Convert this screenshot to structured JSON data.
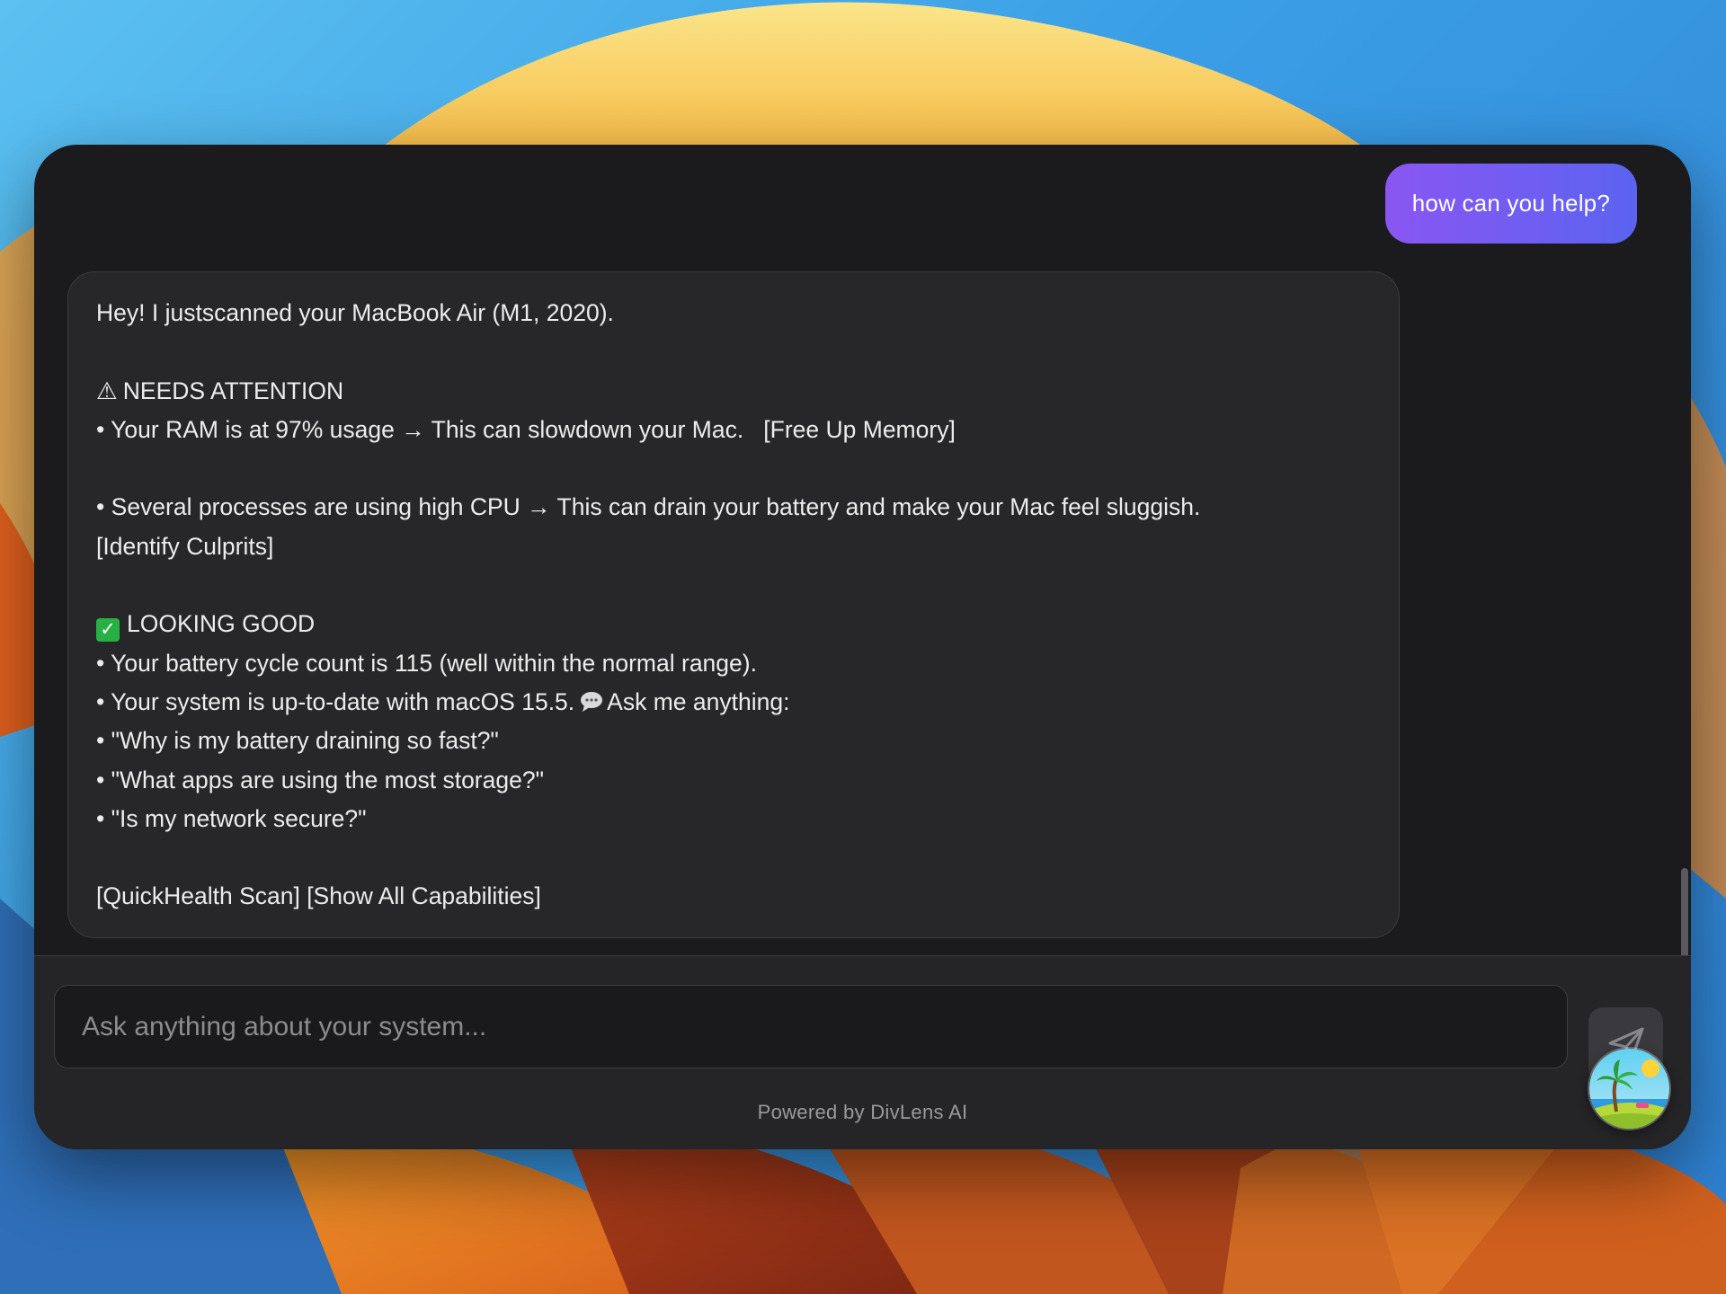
{
  "chat": {
    "user_message": "how can you help?",
    "assistant_lines": [
      "Hey! I justscanned your MacBook Air (M1, 2020).",
      "",
      "NEEDS ATTENTION",
      "• Your RAM is at 97% usage → This can slowdown your Mac.   [Free Up Memory]",
      "",
      "• Several processes are using high CPU → This can drain your battery and make your Mac feel sluggish.",
      "[Identify Culprits]",
      "",
      "LOOKING GOOD",
      "• Your battery cycle count is 115 (well within the normal range).",
      "• Your system is up-to-date with macOS 15.5.",
      "Ask me anything:",
      "• \"Why is my battery draining so fast?\"",
      "• \"What apps are using the most storage?\"",
      "• \"Is my network secure?\"",
      "",
      "[QuickHealth Scan] [Show All Capabilities]"
    ],
    "warning_glyph": "⚠",
    "check_glyph": "✓"
  },
  "input": {
    "placeholder": "Ask anything about your system...",
    "value": ""
  },
  "footer": {
    "powered_by": "Powered by DivLens AI"
  },
  "icons": {
    "send": "send-paper-plane-icon",
    "warning": "warning-triangle-icon",
    "check": "check-mark-icon",
    "speech": "speech-bubble-icon",
    "avatar": "island-palm-avatar"
  },
  "colors": {
    "window_bg": "#1b1b1d",
    "bubble_bg": "#272729",
    "user_bubble_start": "#8a56f2",
    "user_bubble_end": "#5b63f0",
    "text": "#ececec",
    "check_green": "#27b043"
  }
}
